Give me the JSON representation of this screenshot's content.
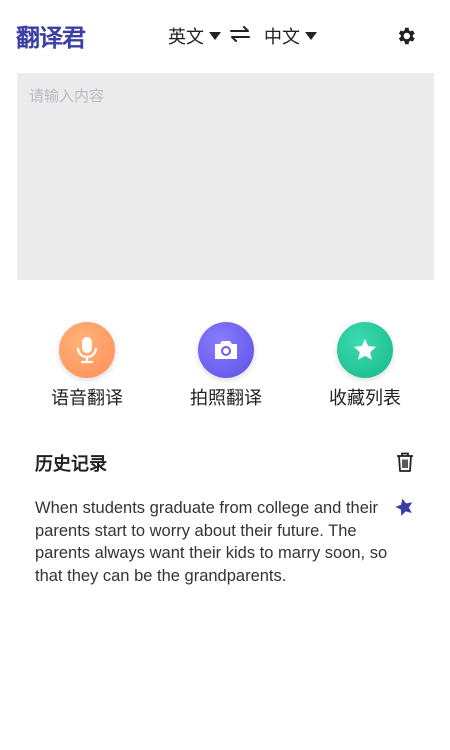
{
  "header": {
    "logo": "翻译君",
    "source_lang": "英文",
    "target_lang": "中文",
    "icons": {
      "swap": "swap-arrows-icon",
      "settings": "gear-icon"
    }
  },
  "input": {
    "placeholder": "请输入内容",
    "value": ""
  },
  "features": [
    {
      "label": "语音翻译",
      "icon": "microphone-icon",
      "color": "#ff9a5c"
    },
    {
      "label": "拍照翻译",
      "icon": "camera-icon",
      "color": "#6a5cf0"
    },
    {
      "label": "收藏列表",
      "icon": "star-icon",
      "color": "#22c59a"
    }
  ],
  "history": {
    "title": "历史记录",
    "items": [
      {
        "text": "When students graduate from college and their parents start to worry about their future. The parents always want their kids to marry soon, so that they can be the grandparents.",
        "starred": true
      }
    ]
  },
  "colors": {
    "brand": "#3a3fa6",
    "input_bg": "#ebebeb",
    "star": "#3a3fa6"
  }
}
